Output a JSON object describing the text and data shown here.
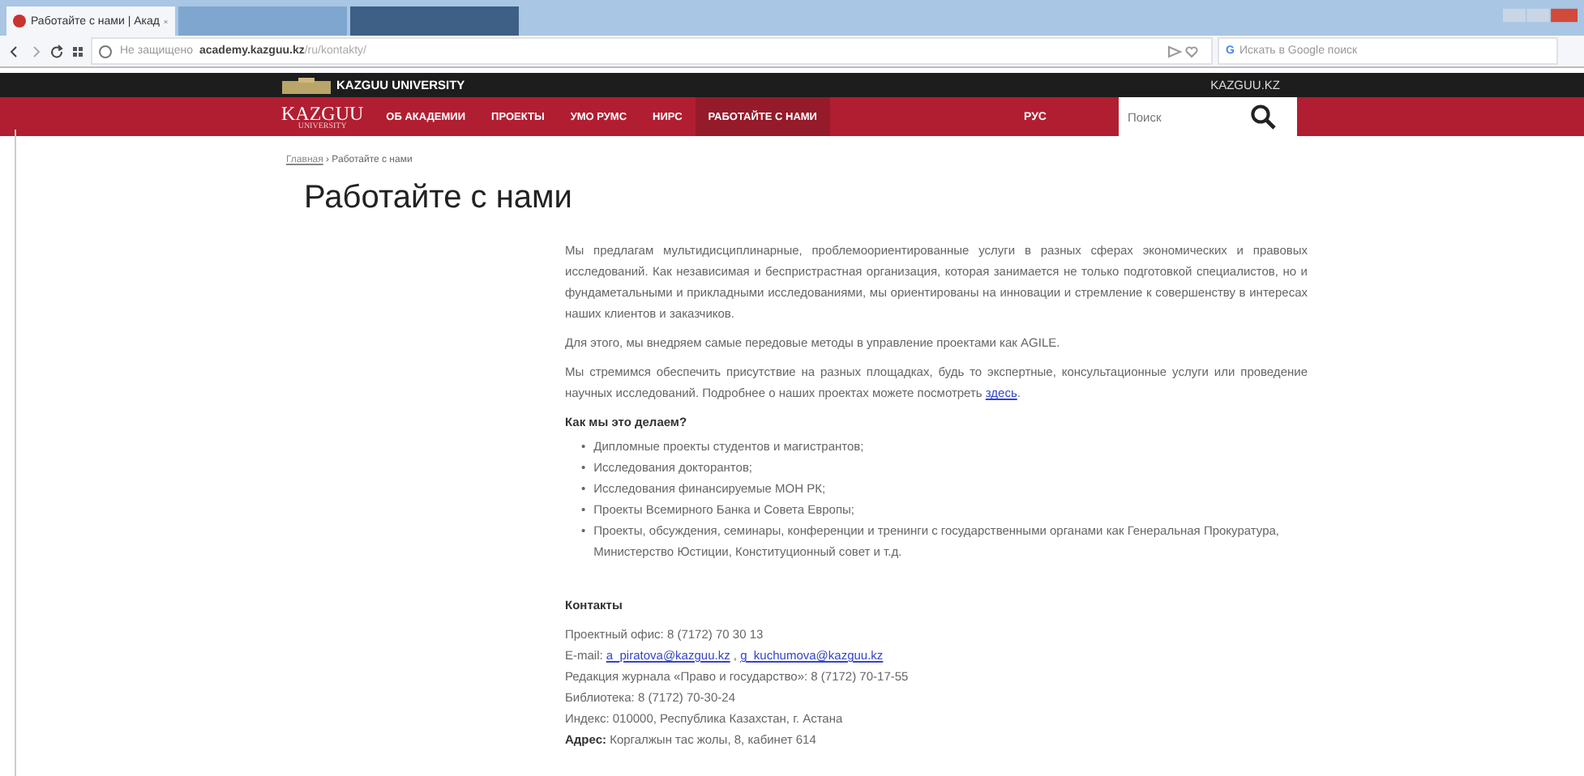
{
  "browser": {
    "tabs": [
      {
        "title": "Работайте с нами | Акад",
        "selected": true
      },
      {
        "selected": false
      },
      {
        "selected": false
      }
    ],
    "security": "Не защищено",
    "url_host": "academy.kazguu.kz",
    "url_path": "/ru/kontakty/",
    "search_engine_mark": "G",
    "search_placeholder": "Искать в Google поиск"
  },
  "topbar": {
    "brand": "KAZGUU UNIVERSITY",
    "site": "KAZGUU.KZ"
  },
  "nav": {
    "logo": "KAZGUU",
    "logo_sub": "UNIVERSITY",
    "items": [
      {
        "label": "ОБ АКАДЕМИИ",
        "selected": false
      },
      {
        "label": "ПРОЕКТЫ",
        "selected": false
      },
      {
        "label": "УМО РУМС",
        "selected": false
      },
      {
        "label": "НИРС",
        "selected": false
      },
      {
        "label": "РАБОТАЙТЕ С НАМИ",
        "selected": true
      }
    ],
    "language": {
      "label": "РУС",
      "selected": false
    },
    "search_placeholder": "Поиск"
  },
  "breadcrumb": {
    "home": "Главная",
    "current": "› Работайте с нами"
  },
  "title": "Работайте с нами",
  "paragraphs": [
    {
      "text": "Мы предлагам мультидисциплинарные, проблемоориентированные услуги в разных сферах экономических и правовых исследований. Как независимая и беспристрастная организация, которая занимается не только подготовкой специалистов, но и фундаметальными и прикладными исследованиями, мы ориентированы на инновации и стремление к совершенству в интересах наших клиентов и заказчиков."
    },
    {
      "text": "Для этого, мы внедряем самые передовые методы в управление проектами как AGILE."
    },
    {
      "text": "Мы стремимся обеспечить присутствие на разных площадках, будь то экспертные, консультационные услуги или проведение научных исследований. Подробнее о наших проектах можете посмотреть ",
      "link": "здесь",
      "after": "."
    }
  ],
  "how_heading": "Как мы это делаем?",
  "bullet": "•",
  "how_items": [
    "Дипломные проекты студентов и магистрантов;",
    "Исследования докторантов;",
    "Исследования финансируемые МОН РК;",
    "Проекты Всемирного Банка и Совета Европы;",
    "Проекты, обсуждения, семинары, конференции и тренинги с государственными органами как Генеральная Прокуратура, Министерство Юстиции, Конституционный совет и т.д."
  ],
  "contacts_heading": "Контакты",
  "contacts": [
    {
      "text": "Проектный офис: 8 (7172) 70 30 13"
    },
    {
      "text": "E-mail: ",
      "separator": " , ",
      "links": [
        "a_piratova@kazguu.kz",
        "g_kuchumova@kazguu.kz"
      ]
    },
    {
      "text": "Редакция журнала «Право и государство»: 8 (7172) 70-17-55"
    },
    {
      "text": "Библиотека: 8 (7172) 70-30-24"
    },
    {
      "text": "Индекс: 010000, Республика Казахстан, г. Астана"
    },
    {
      "text": "**Адрес:** Коргалжын тас жолы, 8, кабинет 614"
    }
  ]
}
